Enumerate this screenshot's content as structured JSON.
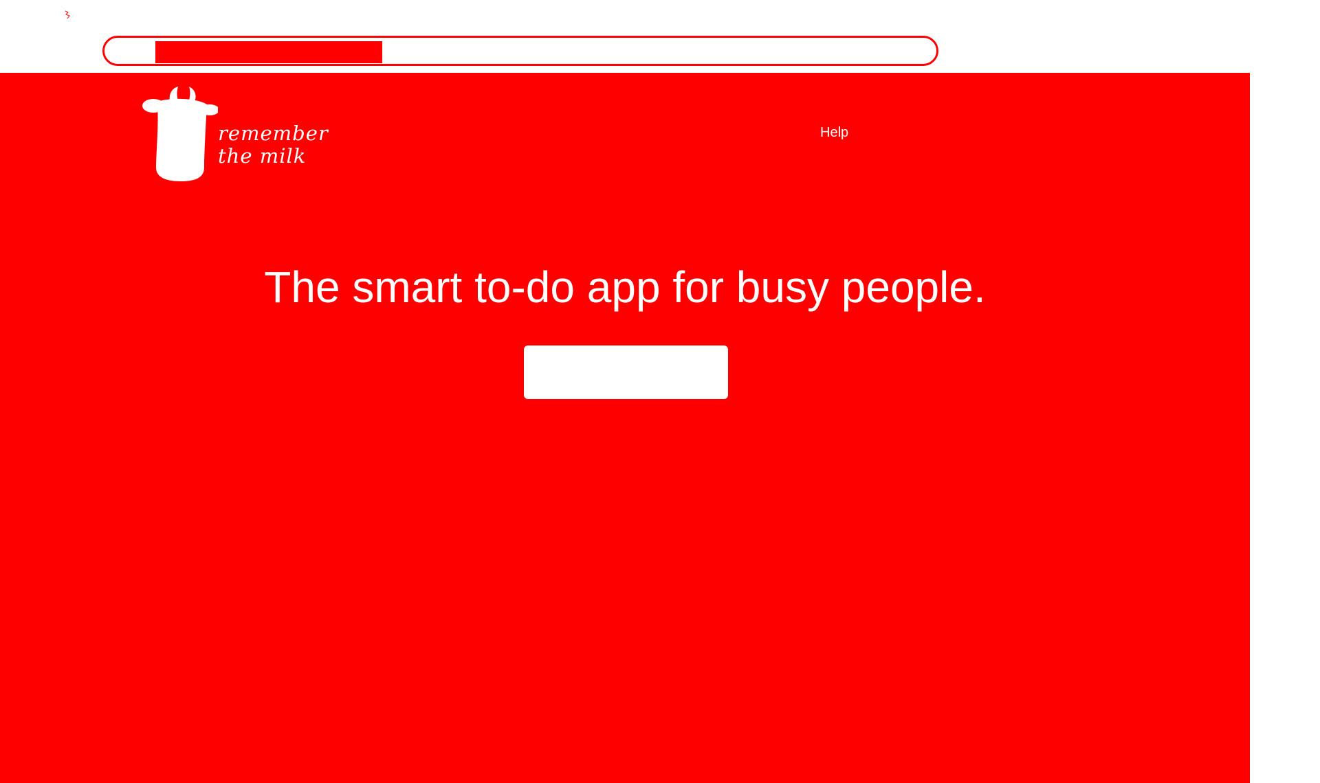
{
  "colors": {
    "brand": "#ff0000",
    "text_on_brand": "#ffffff"
  },
  "browser": {
    "favicon": "favicon-icon"
  },
  "header": {
    "logo": {
      "icon": "cow-icon",
      "line1": "remember",
      "line2": "the milk"
    },
    "nav": {
      "help_label": "Help"
    }
  },
  "hero": {
    "headline": "The smart to-do app for busy people.",
    "cta_label": ""
  }
}
